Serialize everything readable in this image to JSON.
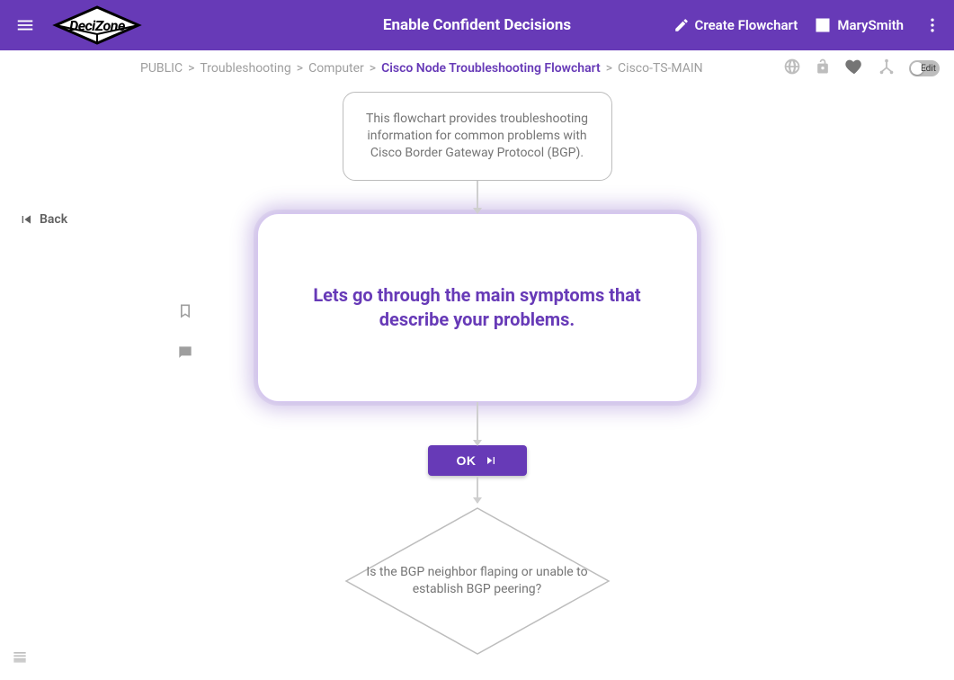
{
  "header": {
    "logo_text": "DeciZone",
    "title": "Enable Confident Decisions",
    "create_label": "Create Flowchart",
    "user_name": "MarySmith"
  },
  "breadcrumb": {
    "items": [
      {
        "label": "PUBLIC"
      },
      {
        "label": "Troubleshooting"
      },
      {
        "label": "Computer"
      },
      {
        "label": "Cisco Node Troubleshooting Flowchart",
        "active": true
      },
      {
        "label": "Cisco-TS-MAIN",
        "last": true
      }
    ],
    "edit_label": "Edit"
  },
  "toolbar_icons": {
    "globe": "globe-icon",
    "lock": "lock-icon",
    "heart": "heart-icon",
    "share": "share-icon"
  },
  "back_label": "Back",
  "flow": {
    "intro": "This flowchart provides troubleshooting information for common problems with Cisco Border Gateway Protocol (BGP).",
    "focus": "Lets go through the main symptoms that describe your problems.",
    "ok_label": "OK",
    "decision": "Is the BGP neighbor flaping or unable to establish BGP peering?"
  },
  "colors": {
    "accent": "#673ab7"
  }
}
